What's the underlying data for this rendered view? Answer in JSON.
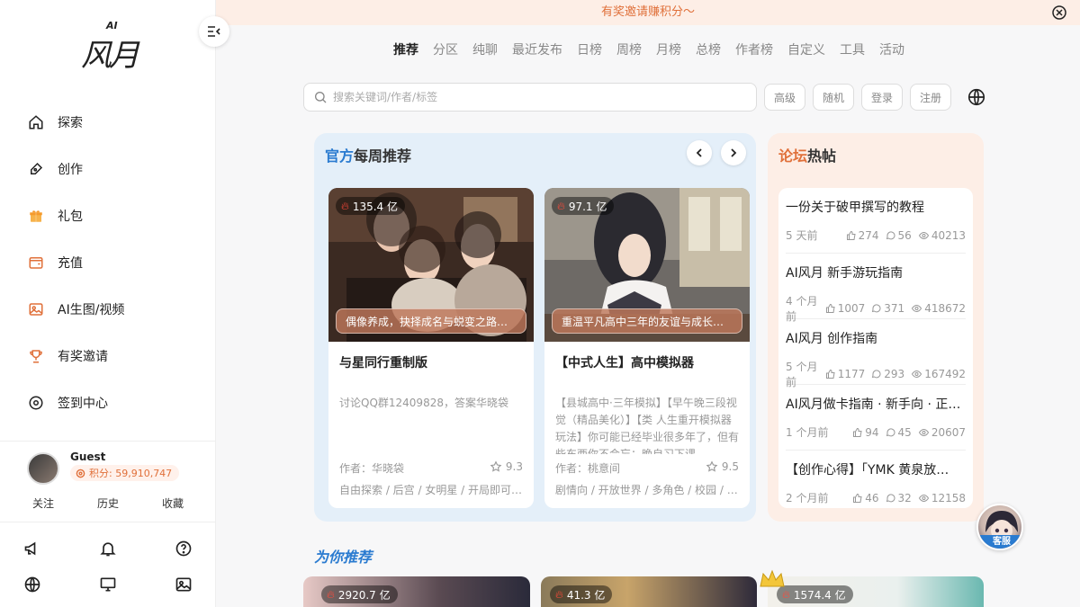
{
  "logo": {
    "ai": "AI",
    "brand": "风月"
  },
  "banner": {
    "text": "有奖邀请赚积分～"
  },
  "sidebar": {
    "items": [
      {
        "label": "探索",
        "icon": "home-icon"
      },
      {
        "label": "创作",
        "icon": "pen-icon"
      },
      {
        "label": "礼包",
        "icon": "gift-icon"
      },
      {
        "label": "充值",
        "icon": "wallet-icon"
      },
      {
        "label": "AI生图/视频",
        "icon": "image-icon"
      },
      {
        "label": "有奖邀请",
        "icon": "trophy-icon"
      },
      {
        "label": "签到中心",
        "icon": "target-icon"
      }
    ],
    "user": {
      "name": "Guest",
      "points": "积分: 59,910,747"
    },
    "links": [
      "关注",
      "历史",
      "收藏"
    ]
  },
  "tabs": [
    "推荐",
    "分区",
    "纯聊",
    "最近发布",
    "日榜",
    "周榜",
    "月榜",
    "总榜",
    "作者榜",
    "自定义",
    "工具",
    "活动"
  ],
  "search": {
    "placeholder": "搜索关键词/作者/标签"
  },
  "buttons": {
    "advanced": "高级",
    "random": "随机",
    "login": "登录",
    "register": "注册"
  },
  "weekly": {
    "title_highlight": "官方",
    "title_rest": "每周推荐",
    "cards": [
      {
        "heat": "135.4 亿",
        "caption": "偶像养成，抉择成名与蜕变之路…",
        "title": "与星同行重制版",
        "desc": "讨论QQ群12409828，答案华晓袋",
        "author": "作者：华晓袋",
        "rating": "9.3",
        "tags": "自由探索 / 后宫 / 女明星 / 开局即可…"
      },
      {
        "heat": "97.1 亿",
        "caption": "重温平凡高中三年的友谊与成长…",
        "title": "【中式人生】高中模拟器",
        "desc": "【县城高中·三年模拟】【早午晚三段视觉（精品美化）】【类 人生重开模拟器 玩法】你可能已经毕业很多年了，但有些东西你不会忘：晚自习下课",
        "author": "作者：桃意间",
        "rating": "9.5",
        "tags": "剧情向 / 开放世界 / 多角色 / 校园 / …"
      }
    ]
  },
  "forum": {
    "title_a": "论坛",
    "title_b": "热帖",
    "posts": [
      {
        "title": "一份关于破甲撰写的教程",
        "time": "5 天前",
        "likes": "274",
        "comments": "56",
        "views": "40213"
      },
      {
        "title": "AI风月 新手游玩指南",
        "time": "4 个月前",
        "likes": "1007",
        "comments": "371",
        "views": "418672"
      },
      {
        "title": "AI风月 创作指南",
        "time": "5 个月前",
        "likes": "1177",
        "comments": "293",
        "views": "167492"
      },
      {
        "title": "AI风月做卡指南 · 新手向 · 正…",
        "time": "1 个月前",
        "likes": "94",
        "comments": "45",
        "views": "20607"
      },
      {
        "title": "【创作心得】「YMK 黄泉放…",
        "time": "2 个月前",
        "likes": "46",
        "comments": "32",
        "views": "12158"
      }
    ]
  },
  "service": {
    "label": "客服"
  },
  "for_you": {
    "title": "为你推荐",
    "cards": [
      {
        "heat": "2920.7 亿"
      },
      {
        "heat": "41.3 亿"
      },
      {
        "heat": "1574.4 亿"
      }
    ]
  },
  "colors": {
    "accent_blue": "#2a7bd0",
    "accent_orange": "#e0703a"
  }
}
